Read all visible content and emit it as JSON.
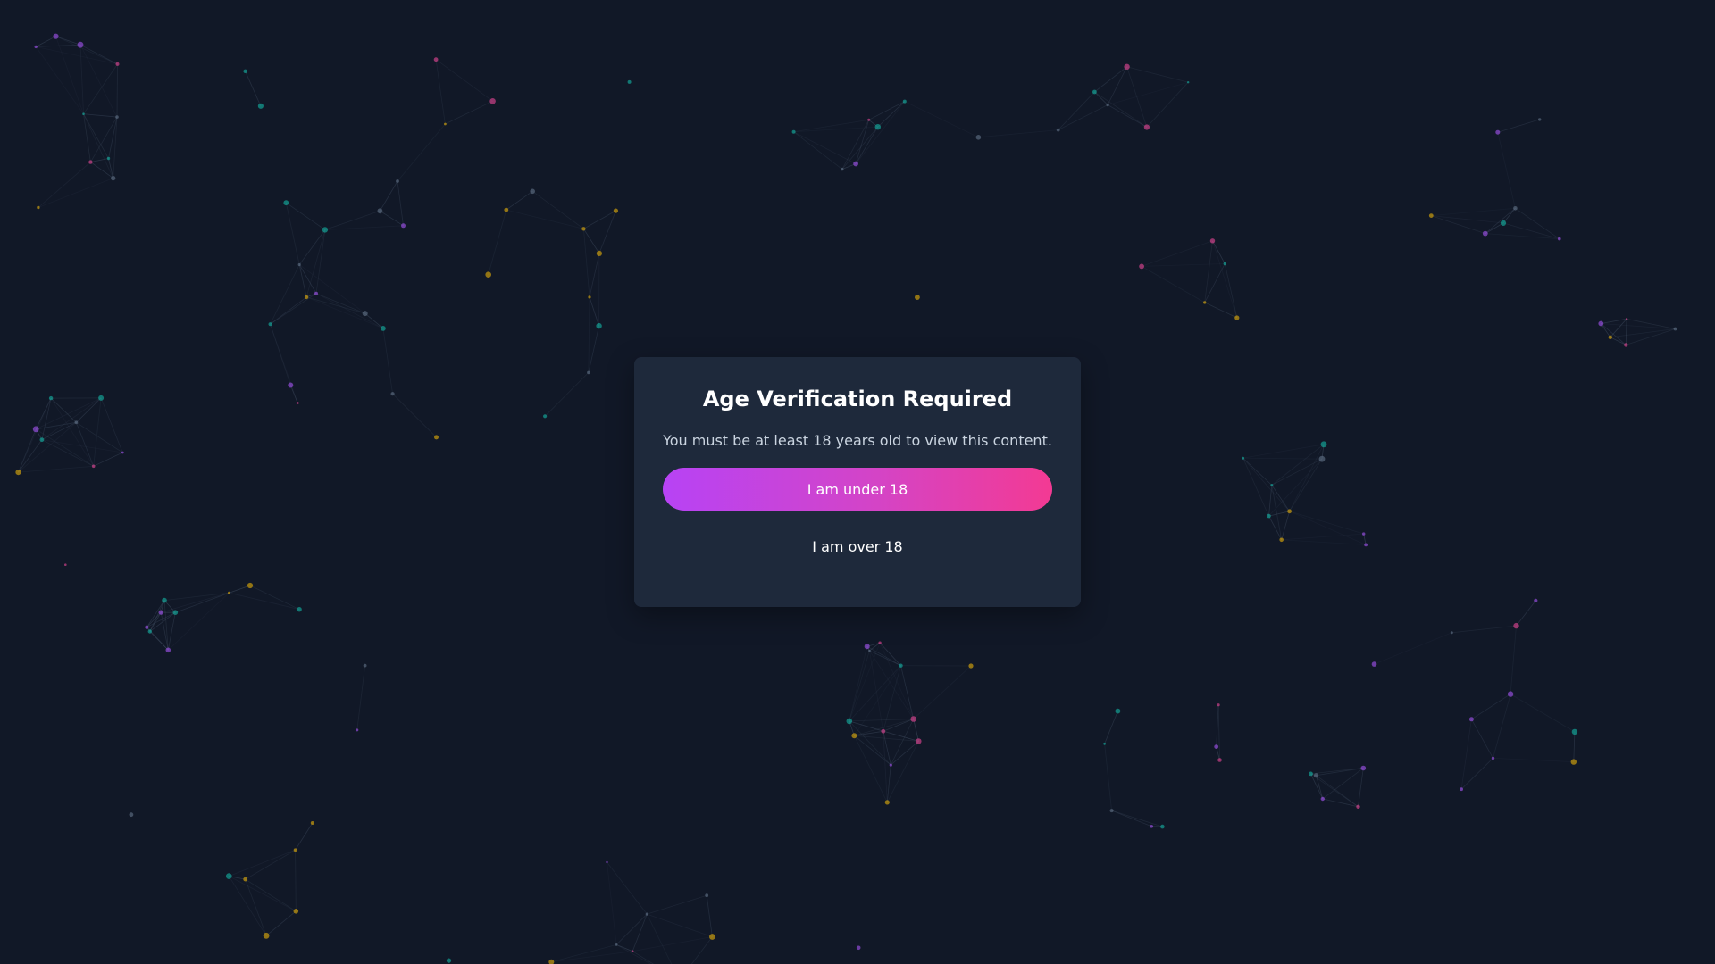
{
  "modal": {
    "title": "Age Verification Required",
    "message": "You must be at least 18 years old to view this content.",
    "under_button_label": "I am under 18",
    "over_button_label": "I am over 18"
  },
  "colors": {
    "background": "#111827",
    "modal_background": "#1e293b",
    "button_gradient_start": "#b743f5",
    "button_gradient_end": "#f33a93",
    "node_colors": [
      "#14b8a6",
      "#eab308",
      "#a855f7",
      "#ec4899",
      "#64748b"
    ]
  }
}
